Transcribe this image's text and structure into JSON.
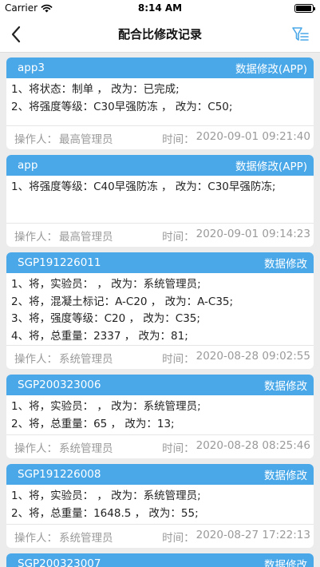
{
  "status_bar": {
    "carrier": "Carrier",
    "time": "8:14 AM",
    "battery_level": 0.95
  },
  "header": {
    "title": "配合比修改记录"
  },
  "records": [
    {
      "code": "app3",
      "type": "数据修改(APP)",
      "lines": [
        "1、将状态：制单 ， 改为：已完成;",
        "2、将强度等级：C30早强防冻 ， 改为：C50;"
      ],
      "operator_label": "操作人：",
      "operator": "最高管理员",
      "time_label": "时间：",
      "time": "2020-09-01 09:21:40"
    },
    {
      "code": "app",
      "type": "数据修改(APP)",
      "lines": [
        "1、将强度等级：C40早强防冻 ， 改为：C30早强防冻;"
      ],
      "operator_label": "操作人：",
      "operator": "最高管理员",
      "time_label": "时间：",
      "time": "2020-09-01 09:14:23"
    },
    {
      "code": "SGP191226011",
      "type": "数据修改",
      "lines": [
        "1、将，实验员： ， 改为：系统管理员;",
        "2、将，混凝土标记：A-C20 ， 改为：A-C35;",
        "3、将，强度等级：C20 ， 改为：C35;",
        "4、将，总重量：2337 ， 改为：81;"
      ],
      "operator_label": "操作人：",
      "operator": "系统管理员",
      "time_label": "时间：",
      "time": "2020-08-28 09:02:55"
    },
    {
      "code": "SGP200323006",
      "type": "数据修改",
      "lines": [
        "1、将，实验员： ， 改为：系统管理员;",
        "2、将，总重量：65 ， 改为：13;"
      ],
      "operator_label": "操作人：",
      "operator": "系统管理员",
      "time_label": "时间：",
      "time": "2020-08-28 08:25:46"
    },
    {
      "code": "SGP191226008",
      "type": "数据修改",
      "lines": [
        "1、将，实验员： ， 改为：系统管理员;",
        "2、将，总重量：1648.5 ， 改为：55;"
      ],
      "operator_label": "操作人：",
      "operator": "系统管理员",
      "time_label": "时间：",
      "time": "2020-08-27 17:22:13"
    },
    {
      "code": "SGP200323007",
      "type": "数据修改",
      "lines": [],
      "operator_label": "",
      "operator": "",
      "time_label": "",
      "time": ""
    }
  ],
  "colors": {
    "accent": "#4aa8e8",
    "background": "#ececec",
    "muted_text": "#9a9a9a"
  },
  "icons": {
    "back": "chevron-left-icon",
    "filter": "filter-list-icon",
    "wifi": "wifi-icon",
    "battery": "battery-icon"
  }
}
